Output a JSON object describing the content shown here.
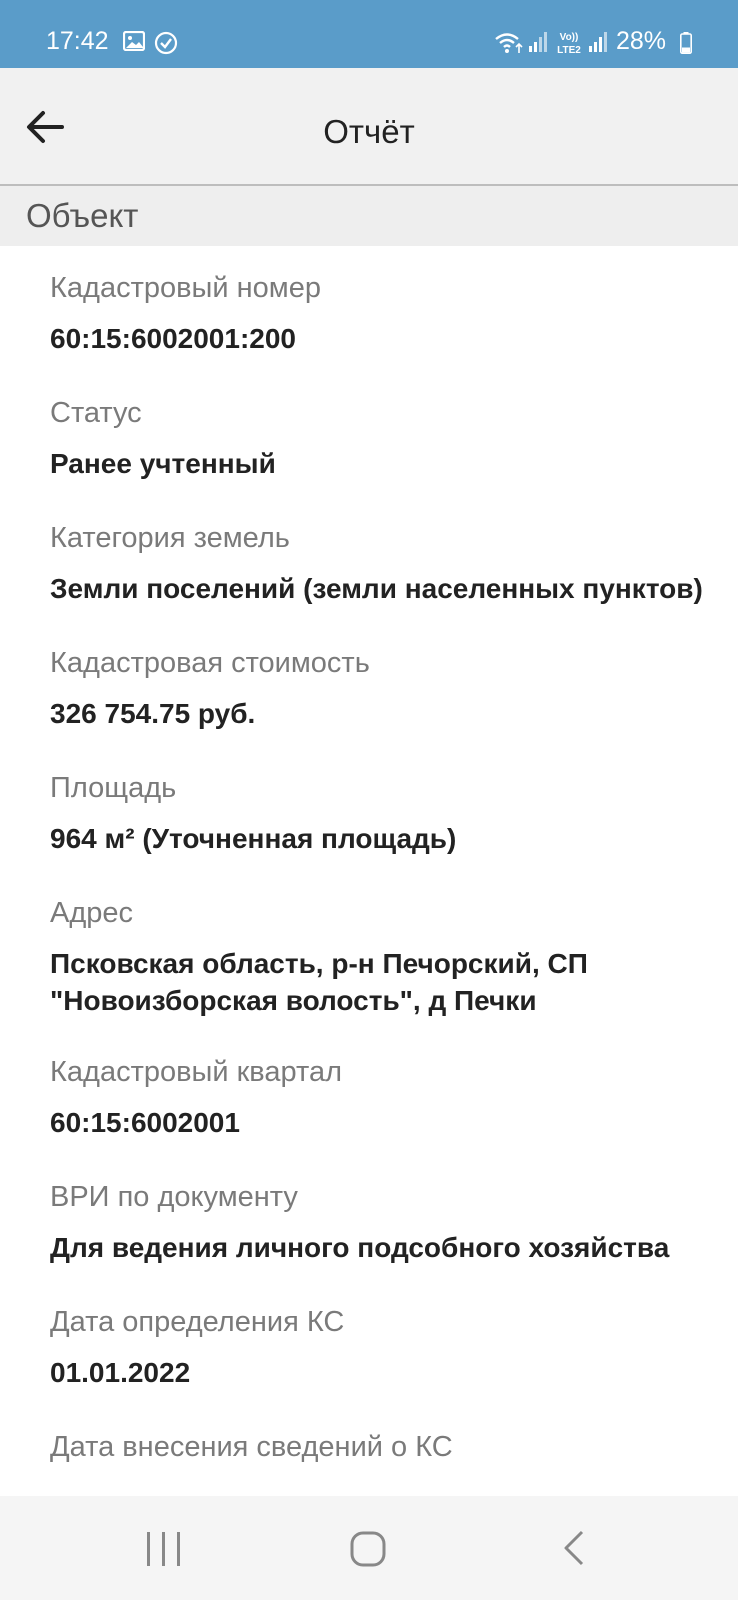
{
  "status_bar": {
    "time": "17:42",
    "battery_percent": "28%",
    "battery_level": 0.28,
    "network_badge": "Vo)) LTE2",
    "icons": [
      "gallery-icon",
      "check-circle-icon",
      "wifi-icon",
      "signal-icon",
      "volte-icon",
      "signal-icon",
      "battery-icon"
    ]
  },
  "app_bar": {
    "title": "Отчёт",
    "back_icon": "arrow-left-icon"
  },
  "section": {
    "title": "Объект"
  },
  "fields": [
    {
      "label": "Кадастровый номер",
      "value": "60:15:6002001:200"
    },
    {
      "label": "Статус",
      "value": "Ранее учтенный"
    },
    {
      "label": "Категория земель",
      "value": "Земли поселений (земли населенных пунктов)"
    },
    {
      "label": "Кадастровая стоимость",
      "value": "326 754.75 руб."
    },
    {
      "label": "Площадь",
      "value": "964 м² (Уточненная площадь)"
    },
    {
      "label": "Адрес",
      "value_lines": [
        "Псковская область, р-н Печорский, СП",
        "\"Новоизборская волость\", д Печки"
      ]
    },
    {
      "label": "Кадастровый квартал",
      "value": "60:15:6002001"
    },
    {
      "label": "ВРИ по документу",
      "value": "Для ведения личного подсобного хозяйства"
    },
    {
      "label": "Дата определения КС",
      "value": "01.01.2022"
    },
    {
      "label": "Дата внесения сведений о КС"
    }
  ],
  "nav_bar": {
    "icons": [
      "recent-apps-icon",
      "home-icon",
      "back-icon"
    ]
  },
  "colors": {
    "status_bar": "#5a9cc9",
    "app_bar": "#f1f1f1",
    "label_text": "#7a7a7a",
    "value_text": "#222222"
  }
}
